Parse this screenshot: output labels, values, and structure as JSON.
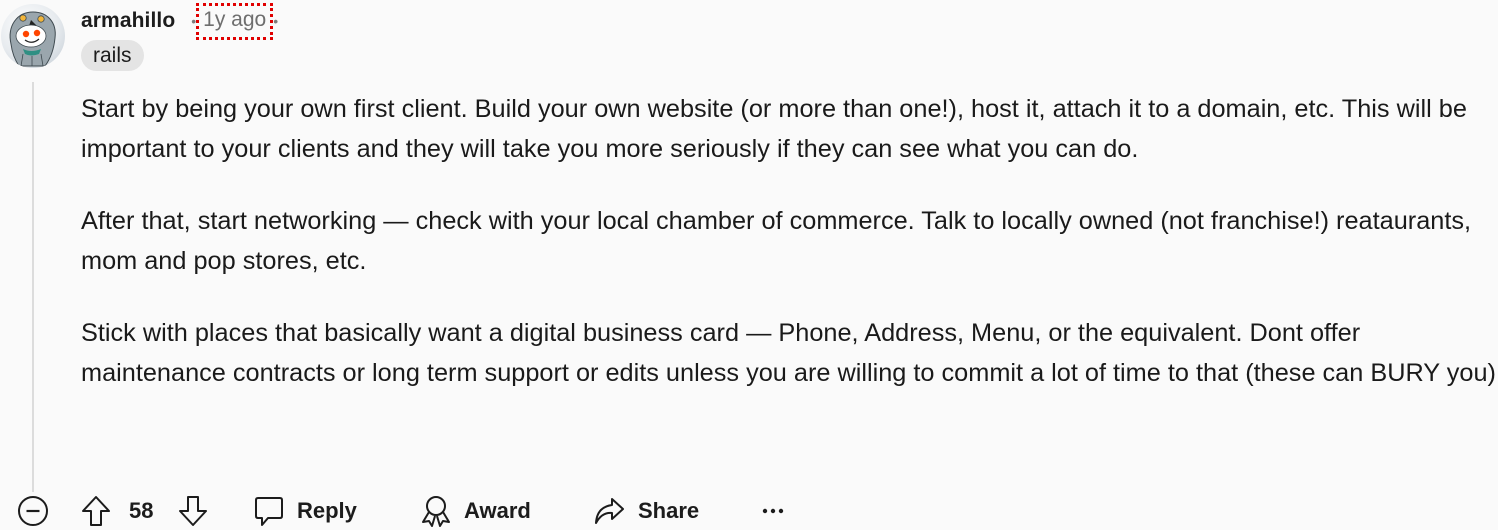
{
  "comment": {
    "author": "armahillo",
    "separator": "•",
    "timestamp": "1y ago",
    "flair": "rails",
    "paragraphs": [
      "Start by being your own first client. Build your own website (or more than one!), host it, attach it to a domain, etc. This will be important to your clients and they will take you more seriously if they can see what you can do.",
      "After that, start networking — check with your local chamber of commerce. Talk to locally owned (not franchise!) reataurants, mom and pop stores, etc.",
      "Stick with places that basically want a digital business card — Phone, Address, Menu, or the equivalent. Dont offer maintenance contracts or long term support or edits unless you are willing to commit a lot of time to that (these can BURY you)"
    ]
  },
  "actions": {
    "collapse_icon": "minus-circle-icon",
    "upvote_icon": "arrow-up-icon",
    "score": "58",
    "downvote_icon": "arrow-down-icon",
    "reply_label": "Reply",
    "reply_icon": "speech-bubble-icon",
    "award_label": "Award",
    "award_icon": "award-ribbon-icon",
    "share_label": "Share",
    "share_icon": "share-arrow-icon",
    "more_label": "•••",
    "more_icon": "ellipsis-icon"
  },
  "colors": {
    "background": "#fafafa",
    "text": "#1c1c1c",
    "meta": "#6e6e6e",
    "flair_bg": "#e4e4e4",
    "thread_line": "#dcdcdc",
    "highlight_outline": "#e00000"
  }
}
